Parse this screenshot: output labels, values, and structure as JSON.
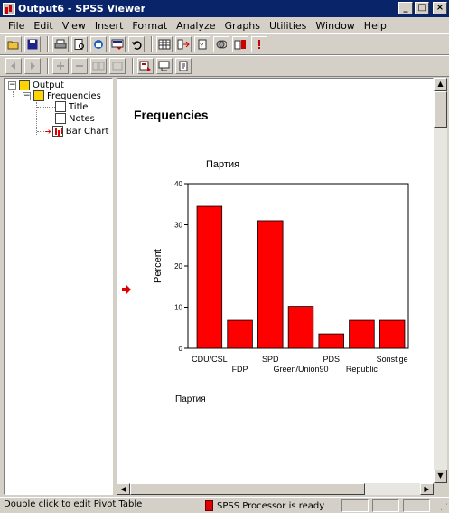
{
  "window": {
    "title": "Output6 - SPSS Viewer",
    "min_label": "_",
    "max_label": "□",
    "close_label": "×"
  },
  "menu": [
    "File",
    "Edit",
    "View",
    "Insert",
    "Format",
    "Analyze",
    "Graphs",
    "Utilities",
    "Window",
    "Help"
  ],
  "toolbar1": [
    "open-icon",
    "save-icon",
    "print-icon",
    "print-preview-icon",
    "export-icon",
    "dialog-recall-icon",
    "undo-icon",
    "goto-data-icon",
    "goto-case-icon",
    "variables-icon",
    "use-sets-icon",
    "designate-window-icon",
    "disabled-icon"
  ],
  "toolbar2": [
    "promote-icon",
    "demote-icon",
    "expand-icon",
    "collapse-icon",
    "show-icon",
    "hide-icon",
    "insert-heading-icon",
    "insert-title-icon",
    "insert-text-icon"
  ],
  "outline": {
    "root": "Output",
    "frequencies": "Frequencies",
    "children": [
      "Title",
      "Notes",
      "Bar Chart"
    ]
  },
  "content": {
    "heading": "Frequencies"
  },
  "chart_data": {
    "type": "bar",
    "title": "Партия",
    "xlabel": "Партия",
    "ylabel": "Percent",
    "ylim": [
      0,
      40
    ],
    "yticks": [
      0,
      10,
      20,
      30,
      40
    ],
    "categories": [
      "CDU/CSL",
      "FDP",
      "SPD",
      "Green/Union90",
      "PDS",
      "Republic",
      "Sonstige"
    ],
    "values": [
      34.5,
      6.8,
      31.0,
      10.2,
      3.5,
      6.8,
      6.8
    ],
    "bar_color": "#ff0000",
    "grid": false
  },
  "status": {
    "left": "Double click to edit Pivot Table",
    "processor": "SPSS Processor  is ready"
  }
}
